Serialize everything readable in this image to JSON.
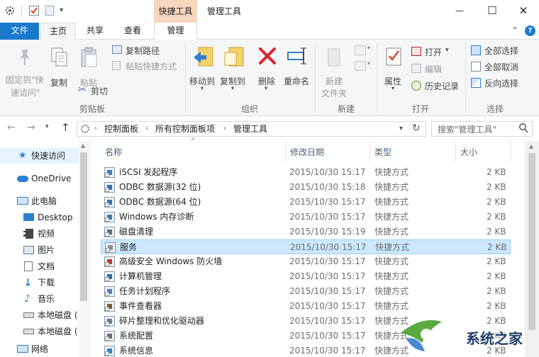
{
  "window": {
    "title": "管理工具",
    "context_header": "快捷工具",
    "minimize": "—",
    "maximize": "☐",
    "close": "✕"
  },
  "tabs": {
    "file": "文件",
    "home": "主页",
    "share": "共享",
    "view": "查看",
    "manage": "管理"
  },
  "ribbon": {
    "clipboard": {
      "pin": [
        "固定到\"快",
        "速访问\""
      ],
      "copy": "复制",
      "paste": "粘贴",
      "copy_path": "复制路径",
      "paste_shortcut": "粘贴快捷方式",
      "cut": "剪切",
      "group": "剪贴板"
    },
    "organize": {
      "move_to": "移动到",
      "copy_to": "复制到",
      "delete": "删除",
      "rename": "重命名",
      "group": "组织"
    },
    "new": {
      "new_folder": [
        "新建",
        "文件夹"
      ],
      "group": "新建"
    },
    "open": {
      "properties": "属性",
      "open": "打开",
      "edit": "编辑",
      "history": "历史记录",
      "group": "打开"
    },
    "select": {
      "select_all": "全部选择",
      "select_none": "全部取消",
      "invert": "反向选择",
      "group": "选择"
    }
  },
  "address": {
    "crumbs": [
      "控制面板",
      "所有控制面板项",
      "管理工具"
    ],
    "search_placeholder": "搜索\"管理工具\""
  },
  "nav": {
    "quick_access": "快速访问",
    "onedrive": "OneDrive",
    "this_pc": "此电脑",
    "desktop": "Desktop",
    "videos": "视频",
    "pictures": "图片",
    "documents": "文档",
    "downloads": "下载",
    "music": "音乐",
    "disk_c": "本地磁盘 (",
    "disk_d": "本地磁盘 (",
    "network": "网络"
  },
  "columns": {
    "name": "名称",
    "date": "修改日期",
    "type": "类型",
    "size": "大小"
  },
  "files": [
    {
      "name": "iSCSI 发起程序",
      "date": "2015/10/30 15:17",
      "type": "快捷方式",
      "size": "2 KB"
    },
    {
      "name": "ODBC 数据源(32 位)",
      "date": "2015/10/30 15:18",
      "type": "快捷方式",
      "size": "2 KB"
    },
    {
      "name": "ODBC 数据源(64 位)",
      "date": "2015/10/30 15:17",
      "type": "快捷方式",
      "size": "2 KB"
    },
    {
      "name": "Windows 内存诊断",
      "date": "2015/10/30 15:17",
      "type": "快捷方式",
      "size": "2 KB"
    },
    {
      "name": "磁盘清理",
      "date": "2015/10/30 15:19",
      "type": "快捷方式",
      "size": "2 KB"
    },
    {
      "name": "服务",
      "date": "2015/10/30 15:17",
      "type": "快捷方式",
      "size": "2 KB"
    },
    {
      "name": "高级安全 Windows 防火墙",
      "date": "2015/10/30 15:17",
      "type": "快捷方式",
      "size": "2 KB"
    },
    {
      "name": "计算机管理",
      "date": "2015/10/30 15:17",
      "type": "快捷方式",
      "size": "2 KB"
    },
    {
      "name": "任务计划程序",
      "date": "2015/10/30 15:17",
      "type": "快捷方式",
      "size": "2 KB"
    },
    {
      "name": "事件查看器",
      "date": "2015/10/30 15:17",
      "type": "快捷方式",
      "size": "2 KB"
    },
    {
      "name": "碎片整理和优化驱动器",
      "date": "2015/10/30 15:17",
      "type": "快捷方式",
      "size": "2 KB"
    },
    {
      "name": "系统配置",
      "date": "2015/10/30 15:17",
      "type": "快捷方式",
      "size": "2 KB"
    },
    {
      "name": "系统信息",
      "date": "2015/10/30 15:17",
      "type": "快捷方式",
      "size": "2 KB"
    }
  ],
  "selected_index": 5,
  "watermark": {
    "text": "系统之家"
  },
  "colors": {
    "accent": "#1979ca",
    "context": "#f7d6c0",
    "selection": "#cce8ff"
  }
}
